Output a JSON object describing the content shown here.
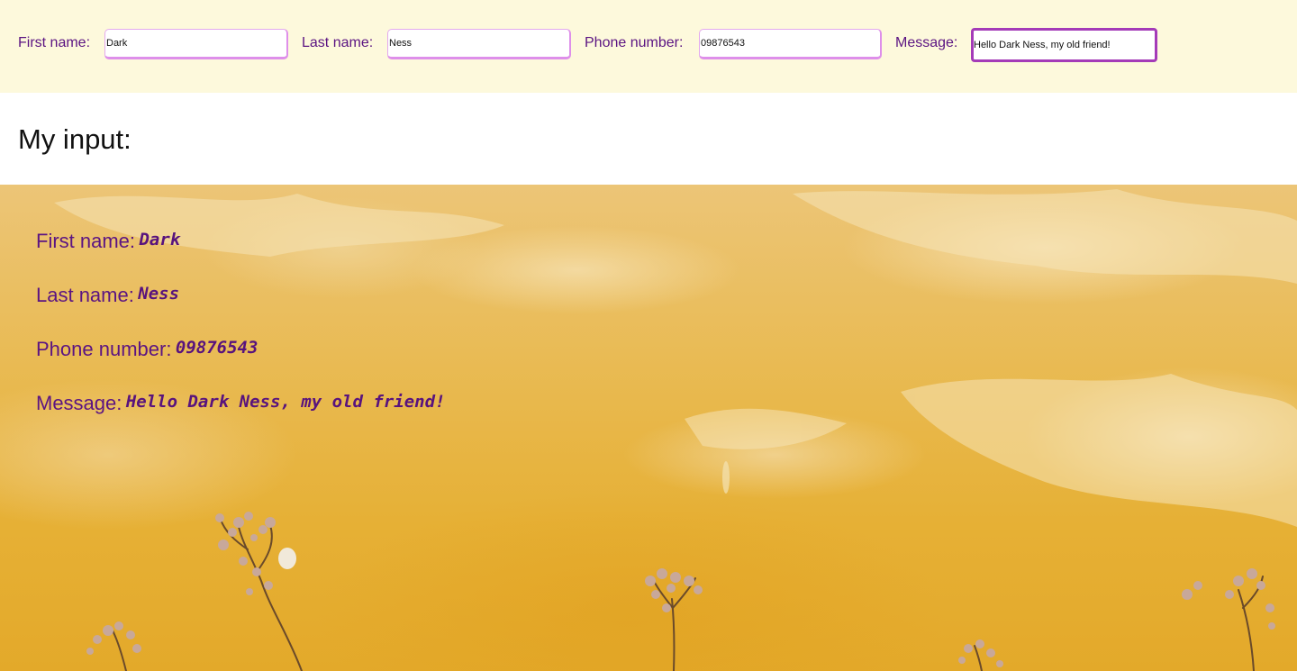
{
  "form": {
    "first_name": {
      "label": "First name:",
      "value": "Dark"
    },
    "last_name": {
      "label": "Last name:",
      "value": "Ness"
    },
    "phone": {
      "label": "Phone number:",
      "value": "09876543"
    },
    "message": {
      "label": "Message:",
      "value": "Hello Dark Ness, my old friend!"
    }
  },
  "heading": "My input:",
  "output": {
    "first_name": {
      "label": "First name:",
      "value": "Dark"
    },
    "last_name": {
      "label": "Last name:",
      "value": "Ness"
    },
    "phone": {
      "label": "Phone number:",
      "value": "09876543"
    },
    "message": {
      "label": "Message:",
      "value": "Hello Dark Ness, my old friend!"
    }
  },
  "colors": {
    "form_bar_bg": "#fdf9dc",
    "label_purple": "#5b1482",
    "input_border": "#de8fea",
    "focused_border": "#a43bb8",
    "wall_yellow": "#e6b035"
  }
}
